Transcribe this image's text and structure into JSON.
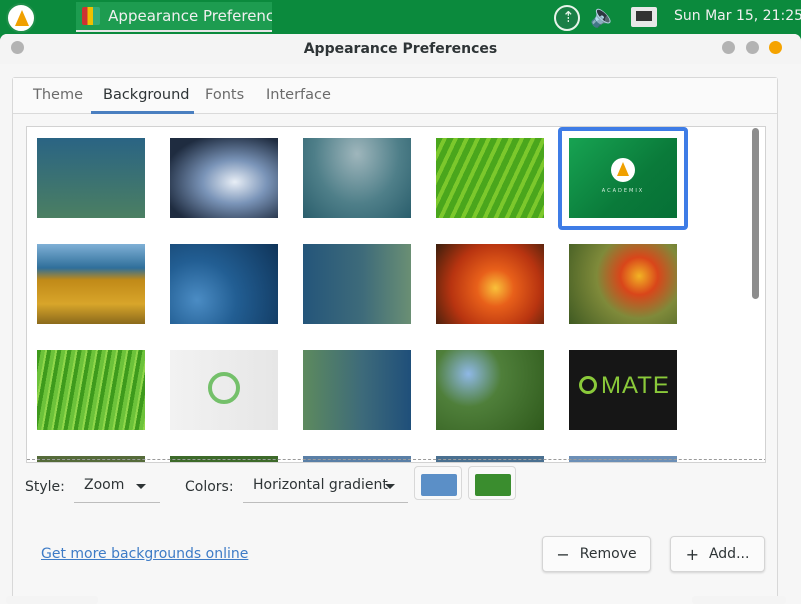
{
  "panel": {
    "task_label": "Appearance Preferenc...",
    "clock": "Sun Mar 15, 21:25",
    "icons": [
      "menu-logo-icon",
      "appearance-app-icon",
      "update-icon",
      "volume-icon",
      "network-icon"
    ]
  },
  "window": {
    "title": "Appearance Preferences"
  },
  "tabs": [
    {
      "label": "Theme"
    },
    {
      "label": "Background"
    },
    {
      "label": "Fonts"
    },
    {
      "label": "Interface"
    }
  ],
  "selected_tab": "Background",
  "backgrounds": {
    "selected_index": 4,
    "thumb_labels": {
      "academix": "ACADEMIX",
      "mate": "MATE"
    }
  },
  "controls": {
    "style_label": "Style:",
    "style_value": "Zoom",
    "colors_label": "Colors:",
    "colors_value": "Horizontal gradient",
    "primary_color": "#5b8fc7",
    "secondary_color": "#3a8d2e"
  },
  "footer": {
    "link": "Get more backgrounds online",
    "remove_label": "Remove",
    "add_label": "Add..."
  },
  "colors": {
    "accent": "#3e7ce6",
    "panel": "#0b8a3d"
  }
}
